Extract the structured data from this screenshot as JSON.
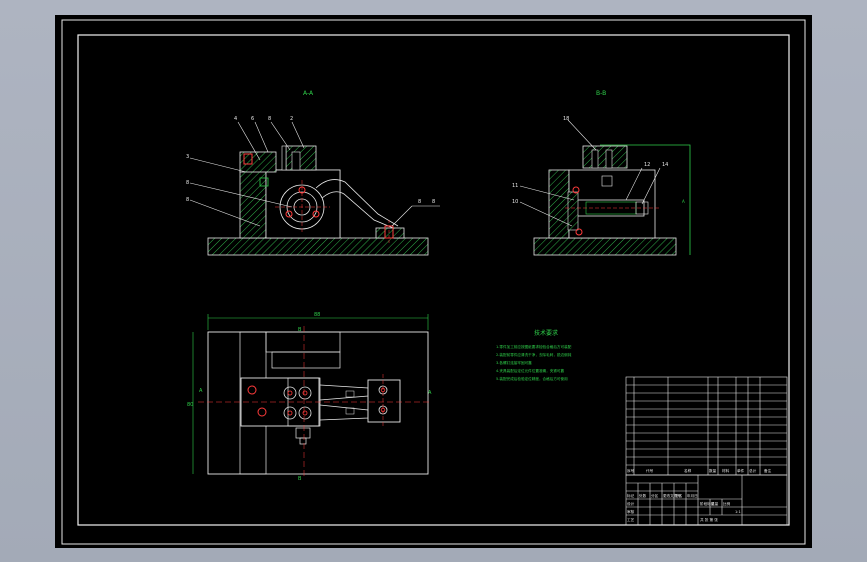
{
  "drawing": {
    "section_title_left": "A-A",
    "section_title_right": "B-B",
    "callouts_top_left": [
      "4",
      "6",
      "8",
      "2"
    ],
    "callouts_side_left": [
      "3",
      "8",
      "8"
    ],
    "callouts_bottom_right_left_view": [
      "8",
      "8"
    ],
    "callouts_right_view_top": [
      "18"
    ],
    "callouts_right_view_left": [
      "11",
      "10"
    ],
    "callouts_right_view_right": [
      "12",
      "14"
    ],
    "dim_top": "88",
    "dim_left": "80",
    "dim_side_label": "A",
    "dim_right_label": "A",
    "dim_bottom_label": "B",
    "dim_top_label": "B"
  },
  "tech_notes": {
    "title": "技术要求",
    "lines": [
      "1.零件加工前应按图纸要求检验合格后方可装配",
      "2.装配前零件应清洗干净，去除毛刺，锐边倒钝",
      "3.各螺钉连接牢固可靠",
      "4.夹具装配后定位元件位置准确，夹紧可靠",
      "5.装配完成后检验定位精度，合格后方可使用"
    ]
  },
  "title_block": {
    "header": [
      "序号",
      "代号",
      "名称",
      "数量",
      "材料",
      "单件",
      "总计",
      "备注"
    ],
    "footer_labels": [
      "标记",
      "处数",
      "分区",
      "更改文件号",
      "签名",
      "年月日"
    ],
    "design_labels": [
      "设计",
      "审核",
      "工艺"
    ],
    "stage_label": "阶段标记",
    "weight_label": "重量",
    "scale_label": "比例",
    "scale_value": "1:1",
    "sheet_label": "共 张 第 张"
  }
}
